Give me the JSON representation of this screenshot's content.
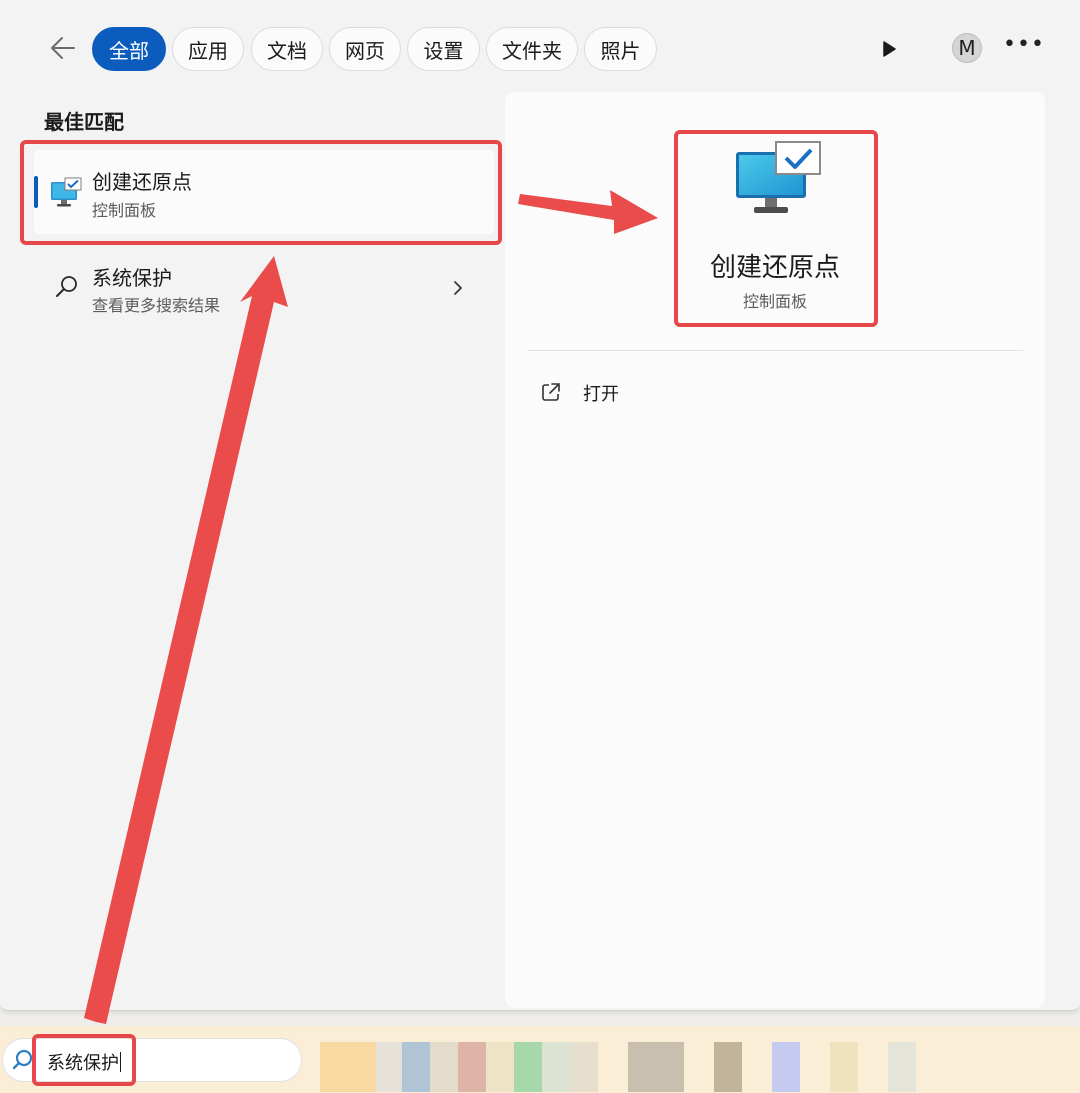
{
  "header": {
    "back_icon": "arrow-left-icon",
    "filters": [
      {
        "label": "全部",
        "active": true
      },
      {
        "label": "应用",
        "active": false
      },
      {
        "label": "文档",
        "active": false
      },
      {
        "label": "网页",
        "active": false
      },
      {
        "label": "设置",
        "active": false
      },
      {
        "label": "文件夹",
        "active": false
      },
      {
        "label": "照片",
        "active": false
      }
    ],
    "play_icon": "play-icon",
    "avatar_initial": "M",
    "more_icon": "more-icon"
  },
  "results": {
    "section_title": "最佳匹配",
    "best_match": {
      "title": "创建还原点",
      "subtitle": "控制面板",
      "icon": "monitor-checkmark-icon"
    },
    "web_search": {
      "title": "系统保护",
      "subtitle": "查看更多搜索结果",
      "icon": "search-icon"
    }
  },
  "detail": {
    "title": "创建还原点",
    "subtitle": "控制面板",
    "icon": "monitor-checkmark-icon",
    "actions": [
      {
        "label": "打开",
        "icon": "open-external-icon"
      }
    ]
  },
  "taskbar": {
    "search_value": "系统保护",
    "search_icon": "search-icon"
  },
  "colors": {
    "accent": "#0b5cbd",
    "annotation_red": "#e8474a",
    "taskbar_bg": "#faeed6"
  }
}
